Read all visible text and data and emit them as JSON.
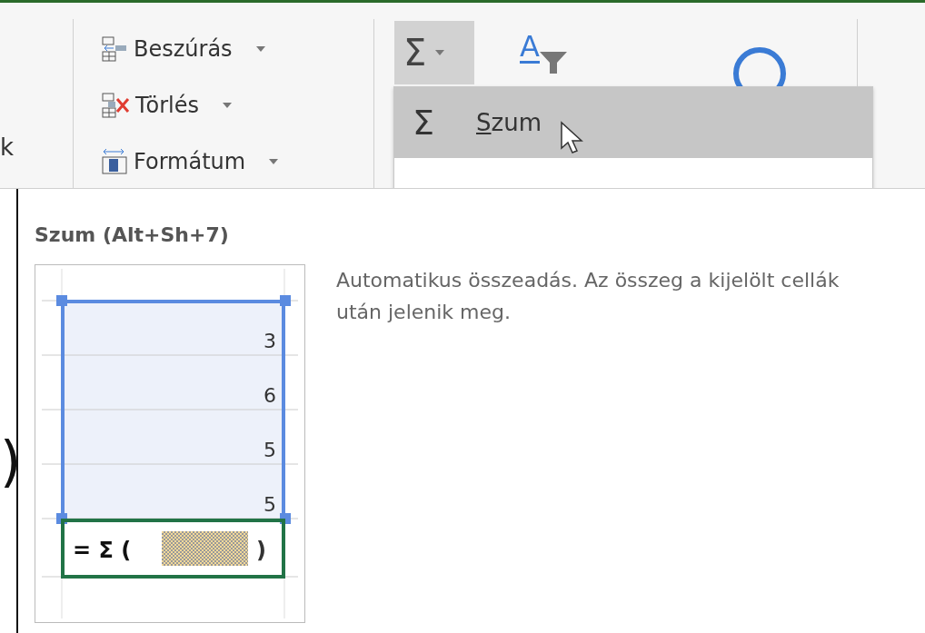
{
  "ribbon": {
    "cut_label": "k",
    "cells_group": [
      {
        "kind": "insert",
        "label": "Beszúrás"
      },
      {
        "kind": "delete",
        "label": "Törlés"
      },
      {
        "kind": "format",
        "label": "Formátum"
      }
    ],
    "autosum_button": {
      "symbol": "Σ",
      "expanded": true
    },
    "sort_button": {
      "letter": "A"
    }
  },
  "dropdown": {
    "items": [
      {
        "symbol": "Σ",
        "label": "Szum",
        "selected": true
      }
    ]
  },
  "margin_text": ")",
  "tooltip": {
    "title": "Szum (Alt+Sh+7)",
    "description": "Automatikus összeadás. Az összeg a kijelölt cellák után jelenik meg.",
    "preview": {
      "values": [
        "3",
        "6",
        "5",
        "5"
      ],
      "formula_start": "= Σ (",
      "formula_end": ")"
    }
  }
}
